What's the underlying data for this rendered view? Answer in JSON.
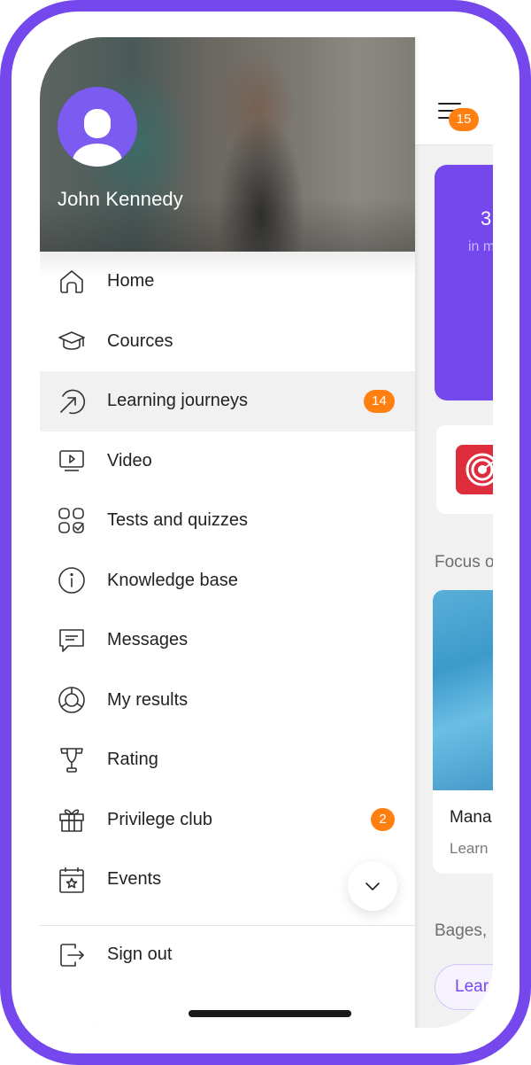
{
  "user": {
    "name": "John Kennedy"
  },
  "menu": {
    "items": [
      {
        "label": "Home",
        "icon": "home-icon"
      },
      {
        "label": "Cources",
        "icon": "graduation-cap-icon"
      },
      {
        "label": "Learning journeys",
        "icon": "journey-arrow-icon",
        "badge": "14",
        "active": true
      },
      {
        "label": "Video",
        "icon": "video-icon"
      },
      {
        "label": "Tests and quizzes",
        "icon": "quiz-grid-icon"
      },
      {
        "label": "Knowledge base",
        "icon": "info-icon"
      },
      {
        "label": "Messages",
        "icon": "message-icon"
      },
      {
        "label": "My results",
        "icon": "results-chart-icon"
      },
      {
        "label": "Rating",
        "icon": "trophy-icon"
      },
      {
        "label": "Privilege club",
        "icon": "gift-icon",
        "badge": "2"
      },
      {
        "label": "Events",
        "icon": "calendar-star-icon"
      }
    ],
    "sign_out": "Sign out"
  },
  "background_app": {
    "notifications_badge": "15",
    "promo": {
      "number": "3",
      "subtitle": "in m"
    },
    "focus_title": "Focus o",
    "course": {
      "title": "Mana",
      "subtitle": "Learn"
    },
    "badges_title": "Bages,",
    "learn_button": "Lear"
  },
  "colors": {
    "brand": "#7548EE",
    "badge": "#FF7F11",
    "active_row": "#F1F1F1",
    "target_tile": "#DE2E3D"
  }
}
